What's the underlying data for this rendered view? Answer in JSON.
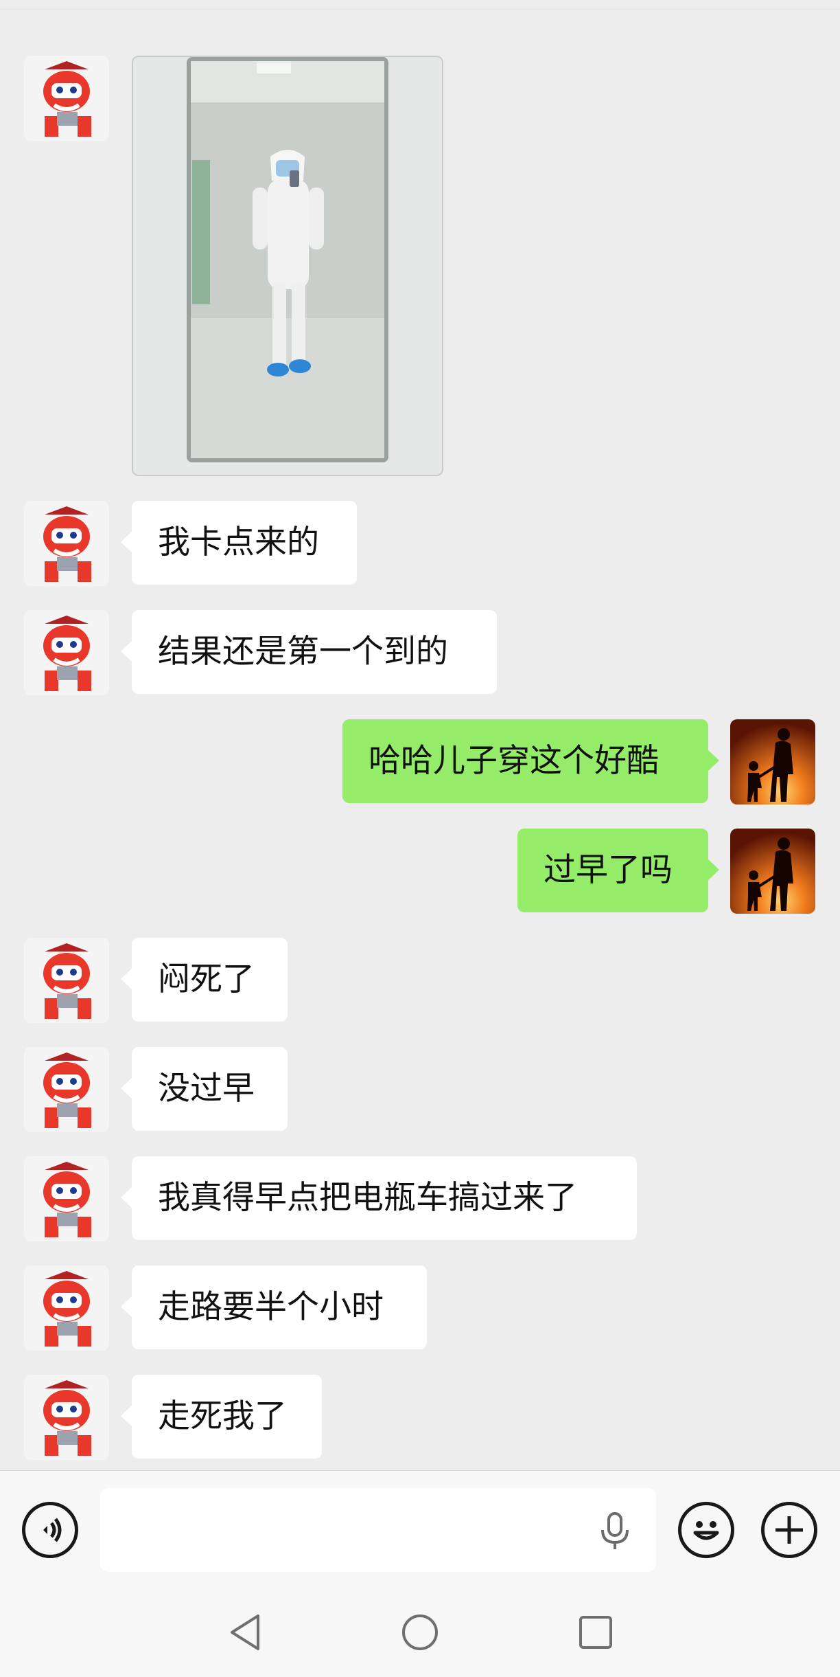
{
  "conversation": {
    "image_message": {
      "sender": "contact",
      "kind": "photo",
      "description_icon": "photo-icon"
    },
    "messages": [
      {
        "sender": "contact",
        "text": "我卡点来的"
      },
      {
        "sender": "contact",
        "text": "结果还是第一个到的"
      },
      {
        "sender": "me",
        "text": "哈哈儿子穿这个好酷"
      },
      {
        "sender": "me",
        "text": "过早了吗"
      },
      {
        "sender": "contact",
        "text": "闷死了"
      },
      {
        "sender": "contact",
        "text": "没过早"
      },
      {
        "sender": "contact",
        "text": "我真得早点把电瓶车搞过来了"
      },
      {
        "sender": "contact",
        "text": "走路要半个小时"
      },
      {
        "sender": "contact",
        "text": "走死我了"
      }
    ]
  },
  "input_bar": {
    "voice_icon": "voice-mode-icon",
    "mic_icon": "microphone-icon",
    "emoji_icon": "emoji-icon",
    "plus_icon": "plus-icon",
    "message_value": ""
  },
  "nav_bar": {
    "back_icon": "back-triangle-icon",
    "home_icon": "home-circle-icon",
    "recents_icon": "recents-square-icon"
  },
  "colors": {
    "background": "#ededed",
    "incoming_bubble": "#ffffff",
    "outgoing_bubble": "#95ec69",
    "avatar_red": "#e8382c"
  }
}
